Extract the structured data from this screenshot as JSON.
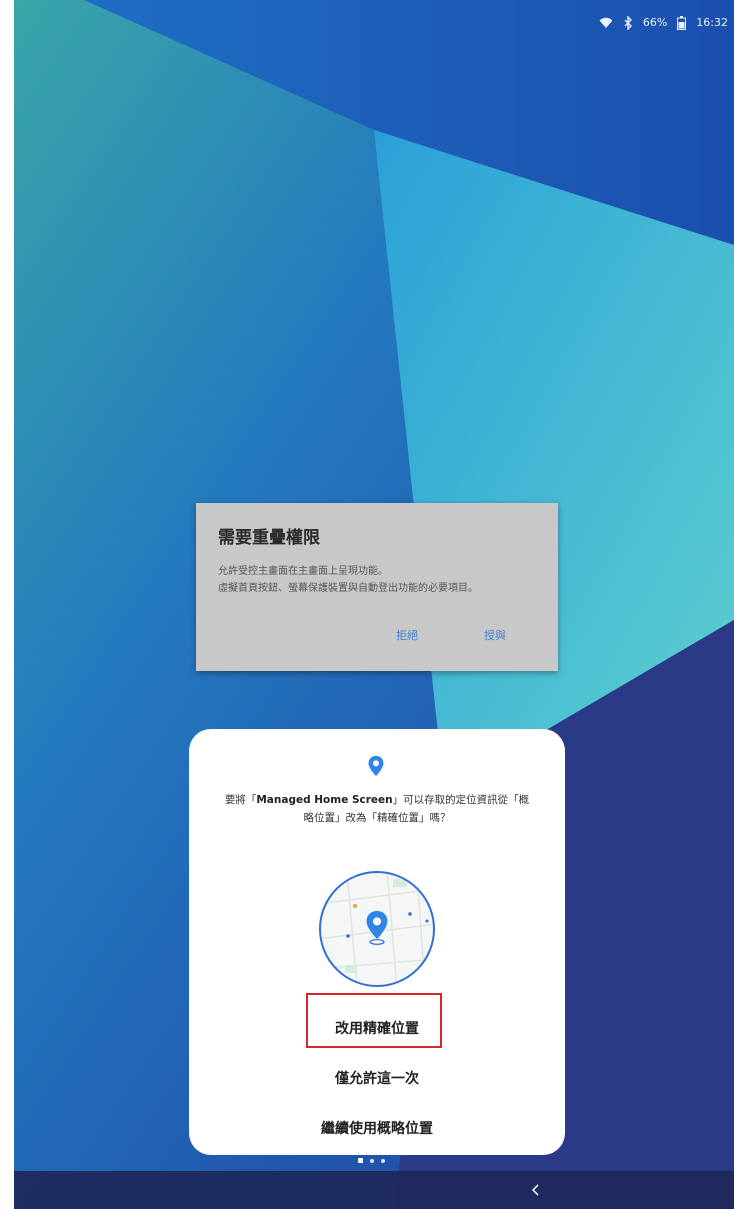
{
  "status_bar": {
    "battery": "66%",
    "time": "16:32",
    "icons": [
      "wifi-icon",
      "bluetooth-icon",
      "battery-icon"
    ]
  },
  "overlay_dialog": {
    "title": "需要重疊權限",
    "body_line1": "允許受控主畫面在主畫面上呈現功能。",
    "body_line2": "虛擬首頁按鈕、螢幕保護裝置與自動登出功能的必要項目。",
    "deny_label": "拒絕",
    "grant_label": "授與"
  },
  "permission_dialog": {
    "icon": "location-pin-icon",
    "question_prefix": "要將「",
    "app_name": "Managed Home Screen",
    "question_suffix_line1": "」可以存取的定位資訊從「概",
    "question_line2": "略位置」改為「精確位置」嗎？",
    "choice_precise": "改用精確位置",
    "choice_once": "僅允許這一次",
    "choice_approx": "繼續使用概略位置",
    "highlight_color": "#d8262a"
  },
  "page_indicator": {
    "count": 3,
    "active_index": 0
  },
  "nav_bar": {
    "back_icon": "back-chevron-icon"
  },
  "colors": {
    "accent_blue": "#3f7fd0",
    "pin_blue": "#2f86e6"
  }
}
